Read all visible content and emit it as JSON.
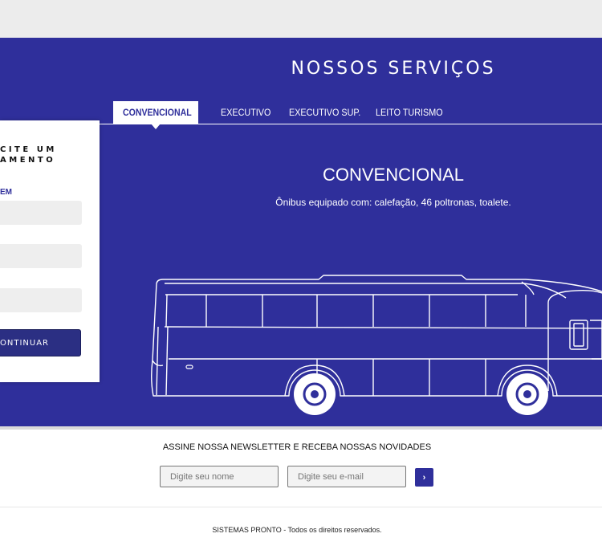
{
  "hero": {
    "title": "NOSSOS SERVIÇOS",
    "tabs": [
      {
        "label": "CONVENCIONAL"
      },
      {
        "label": "EXECUTIVO"
      },
      {
        "label": "EXECUTIVO SUP."
      },
      {
        "label": "LEITO TURISMO"
      }
    ],
    "service_name": "CONVENCIONAL",
    "service_desc": "Ônibus equipado com: calefação, 46 poltronas, toalete."
  },
  "quote_form": {
    "title": "CITE UM AMENTO",
    "label": "EM",
    "button": "ONTINUAR"
  },
  "newsletter": {
    "heading": "ASSINE NOSSA NEWSLETTER E RECEBA NOSSAS NOVIDADES",
    "name_placeholder": "Digite seu nome",
    "email_placeholder": "Digite seu e-mail",
    "submit_icon": "chevron-right-icon"
  },
  "footer": {
    "brand": "SISTEMAS PRONTO",
    "text": " - Todos os direitos reservados."
  },
  "colors": {
    "primary": "#2f2f9b",
    "button_dark": "#2b2f83"
  }
}
